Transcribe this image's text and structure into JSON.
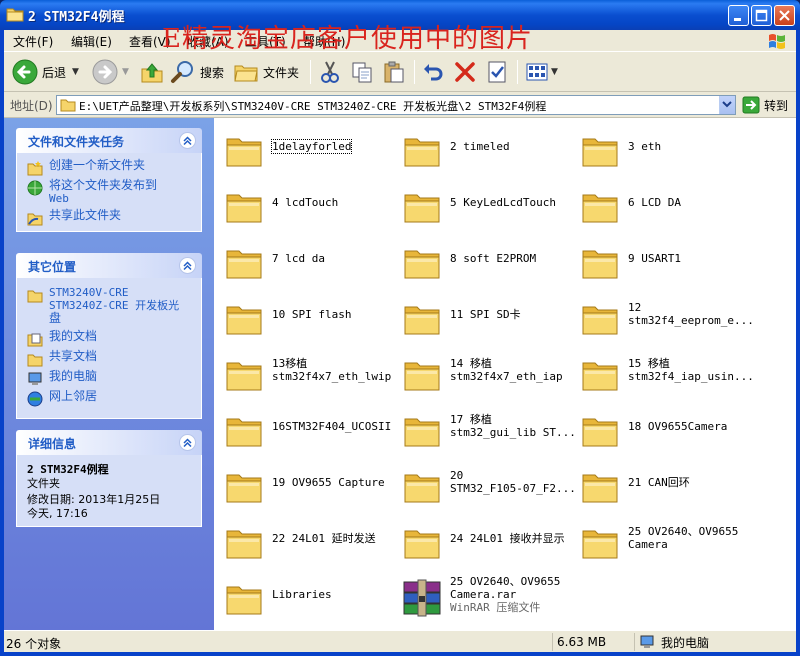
{
  "window": {
    "title": "2 STM32F4例程",
    "watermark": "E精灵淘宝店客户使用中的图片"
  },
  "menu": [
    {
      "label": "文件(F)"
    },
    {
      "label": "编辑(E)"
    },
    {
      "label": "查看(V)"
    },
    {
      "label": "收藏(A)"
    },
    {
      "label": "工具(T)"
    },
    {
      "label": "帮助(H)"
    }
  ],
  "toolbar": {
    "back_label": "后退",
    "search_label": "搜索",
    "folders_label": "文件夹"
  },
  "address": {
    "label": "地址(D)",
    "path": "E:\\UET产品整理\\开发板系列\\STM3240V-CRE STM3240Z-CRE 开发板光盘\\2 STM32F4例程",
    "go_label": "转到"
  },
  "tasks": {
    "file_tasks": {
      "title": "文件和文件夹任务",
      "links": [
        {
          "label": "创建一个新文件夹"
        },
        {
          "label_line1": "将这个文件夹发布到",
          "label_line2": "Web"
        },
        {
          "label": "共享此文件夹"
        }
      ]
    },
    "other_places": {
      "title": "其它位置",
      "links": [
        {
          "line1": "STM3240V-CRE",
          "line2": "STM3240Z-CRE 开发板光",
          "line3": "盘"
        },
        {
          "label": "我的文档"
        },
        {
          "label": "共享文档"
        },
        {
          "label": "我的电脑"
        },
        {
          "label": "网上邻居"
        }
      ]
    },
    "details": {
      "title": "详细信息",
      "name": "2 STM32F4例程",
      "type": "文件夹",
      "modified_line1": "修改日期: 2013年1月25日",
      "modified_line2": "今天, 17:16"
    }
  },
  "files": [
    {
      "l1": "1delayforled",
      "l2": "",
      "kind": "folder"
    },
    {
      "l1": "2 timeled",
      "l2": "",
      "kind": "folder"
    },
    {
      "l1": "3 eth",
      "l2": "",
      "kind": "folder"
    },
    {
      "l1": "4 lcdTouch",
      "l2": "",
      "kind": "folder"
    },
    {
      "l1": "5 KeyLedLcdTouch",
      "l2": "",
      "kind": "folder"
    },
    {
      "l1": "6 LCD DA",
      "l2": "",
      "kind": "folder"
    },
    {
      "l1": "7 lcd da",
      "l2": "",
      "kind": "folder"
    },
    {
      "l1": "8 soft E2PROM",
      "l2": "",
      "kind": "folder"
    },
    {
      "l1": "9 USART1",
      "l2": "",
      "kind": "folder"
    },
    {
      "l1": "10 SPI flash",
      "l2": "",
      "kind": "folder"
    },
    {
      "l1": "11 SPI SD卡",
      "l2": "",
      "kind": "folder"
    },
    {
      "l1": "12",
      "l2": "stm32f4_eeprom_e...",
      "kind": "folder"
    },
    {
      "l1": "13移植",
      "l2": "stm32f4x7_eth_lwip",
      "kind": "folder"
    },
    {
      "l1": "14 移植",
      "l2": "stm32f4x7_eth_iap",
      "kind": "folder"
    },
    {
      "l1": "15 移植",
      "l2": "stm32f4_iap_usin...",
      "kind": "folder"
    },
    {
      "l1": "16STM32F404_UCOSII",
      "l2": "",
      "kind": "folder"
    },
    {
      "l1": "17 移植",
      "l2": "stm32_gui_lib ST...",
      "kind": "folder"
    },
    {
      "l1": "18 OV9655Camera",
      "l2": "",
      "kind": "folder"
    },
    {
      "l1": "19 OV9655 Capture",
      "l2": "",
      "kind": "folder"
    },
    {
      "l1": "20",
      "l2": "STM32_F105-07_F2...",
      "kind": "folder"
    },
    {
      "l1": "21 CAN回环",
      "l2": "",
      "kind": "folder"
    },
    {
      "l1": "22 24L01 延时发送",
      "l2": "",
      "kind": "folder"
    },
    {
      "l1": "24 24L01 接收并显示",
      "l2": "",
      "kind": "folder"
    },
    {
      "l1": "25 OV2640、OV9655",
      "l2": "Camera",
      "kind": "folder"
    },
    {
      "l1": "Libraries",
      "l2": "",
      "kind": "folder"
    },
    {
      "l1": "25 OV2640、OV9655",
      "l2": "Camera.rar",
      "l3": "WinRAR 压缩文件",
      "kind": "rar"
    }
  ],
  "status": {
    "count": "26 个对象",
    "size": "6.63 MB",
    "location": "我的电脑"
  },
  "colors": {
    "titlebar": "#0a4fd0",
    "task_pane": "#7ba2e7",
    "link": "#215dc6",
    "watermark": "#d9241e",
    "folder": "#f5d46a"
  }
}
